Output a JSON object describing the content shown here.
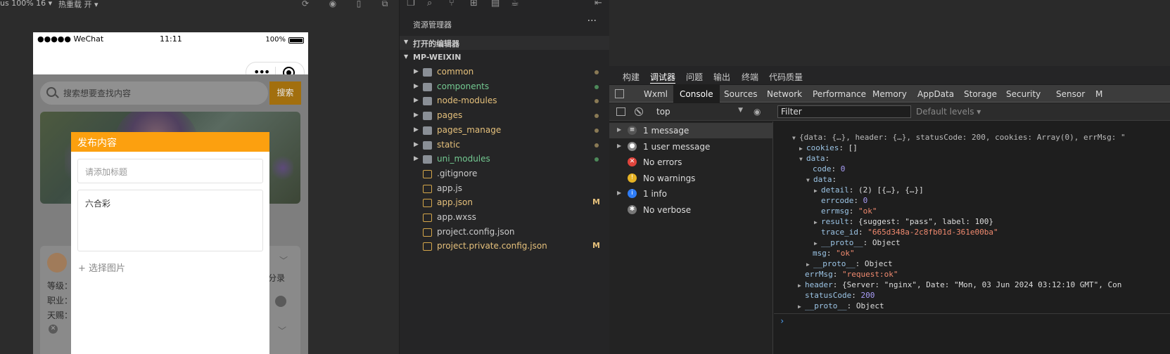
{
  "simulator": {
    "toolbar": {
      "zoom_label": "us 100% 16 ▾",
      "hotreload_label": "热重载 开 ▾"
    },
    "statusbar": {
      "carrier": "●●●●● WeChat",
      "time": "11:11",
      "battery": "100%"
    },
    "search": {
      "placeholder": "搜索想要查找内容",
      "button": "搜索"
    },
    "card": {
      "fields": [
        "等级：",
        "职业：",
        "天赐："
      ],
      "share": "分录"
    },
    "dialog": {
      "title": "发布内容",
      "title_placeholder": "请添加标题",
      "content_value": "六合彩",
      "pick_images": "+ 选择图片"
    }
  },
  "explorer": {
    "title": "资源管理器",
    "more": "···",
    "open_editors": "打开的编辑器",
    "project": "MP-WEIXIN",
    "items": [
      {
        "name": "common",
        "type": "folder",
        "color": "#e5c07b",
        "status": "dot",
        "dot_color": "#8a7a55"
      },
      {
        "name": "components",
        "type": "folder",
        "color": "#73c991",
        "status": "dot",
        "dot_color": "#4d8a5a"
      },
      {
        "name": "node-modules",
        "type": "folder",
        "color": "#e5c07b",
        "status": "dot",
        "dot_color": "#8a7a55"
      },
      {
        "name": "pages",
        "type": "folder",
        "color": "#e5c07b",
        "status": "dot",
        "dot_color": "#8a7a55"
      },
      {
        "name": "pages_manage",
        "type": "folder",
        "color": "#e5c07b",
        "status": "dot",
        "dot_color": "#8a7a55"
      },
      {
        "name": "static",
        "type": "folder",
        "color": "#e5c07b",
        "status": "dot",
        "dot_color": "#8a7a55"
      },
      {
        "name": "uni_modules",
        "type": "folder",
        "color": "#73c991",
        "status": "dot",
        "dot_color": "#4d8a5a"
      },
      {
        "name": ".gitignore",
        "type": "file",
        "color": "#cccccc",
        "status": "",
        "dot_color": ""
      },
      {
        "name": "app.js",
        "type": "file",
        "color": "#cccccc",
        "status": "",
        "dot_color": ""
      },
      {
        "name": "app.json",
        "type": "file",
        "color": "#e5c07b",
        "status": "M",
        "dot_color": ""
      },
      {
        "name": "app.wxss",
        "type": "file",
        "color": "#cccccc",
        "status": "",
        "dot_color": ""
      },
      {
        "name": "project.config.json",
        "type": "file",
        "color": "#cccccc",
        "status": "",
        "dot_color": ""
      },
      {
        "name": "project.private.config.json",
        "type": "file",
        "color": "#e5c07b",
        "status": "M",
        "dot_color": ""
      }
    ]
  },
  "devtools": {
    "top_tabs": [
      "构建",
      "调试器",
      "问题",
      "输出",
      "终端",
      "代码质量"
    ],
    "top_active": "调试器",
    "panel_tabs": [
      "Wxml",
      "Console",
      "Sources",
      "Network",
      "Performance",
      "Memory",
      "AppData",
      "Storage",
      "Security",
      "Sensor",
      "M"
    ],
    "panel_active": "Console",
    "context": "top",
    "filter_placeholder": "Filter",
    "levels": "Default levels ▾",
    "sidebar": [
      {
        "label": "1 message",
        "icon": "list-icon",
        "expandable": true
      },
      {
        "label": "1 user message",
        "icon": "user-icon",
        "expandable": true
      },
      {
        "label": "No errors",
        "icon": "error-icon",
        "expandable": false
      },
      {
        "label": "No warnings",
        "icon": "warning-icon",
        "expandable": false
      },
      {
        "label": "1 info",
        "icon": "info-icon",
        "expandable": true
      },
      {
        "label": "No verbose",
        "icon": "gear-icon",
        "expandable": false
      }
    ],
    "output": {
      "summary": "{data: {…}, header: {…}, statusCode: 200, cookies: Array(0), errMsg: \"",
      "cookies": "[]",
      "code": "0",
      "detail": "(2) [{…}, {…}]",
      "errcode": "0",
      "errmsg": "\"ok\"",
      "result": "{suggest: \"pass\", label: 100}",
      "trace_id": "\"665d348a-2c8fb01d-361e00ba\"",
      "proto": "Object",
      "msg": "\"ok\"",
      "errMsg": "\"request:ok\"",
      "header": "{Server: \"nginx\", Date: \"Mon, 03 Jun 2024 03:12:10 GMT\", Con",
      "statusCode": "200"
    }
  }
}
